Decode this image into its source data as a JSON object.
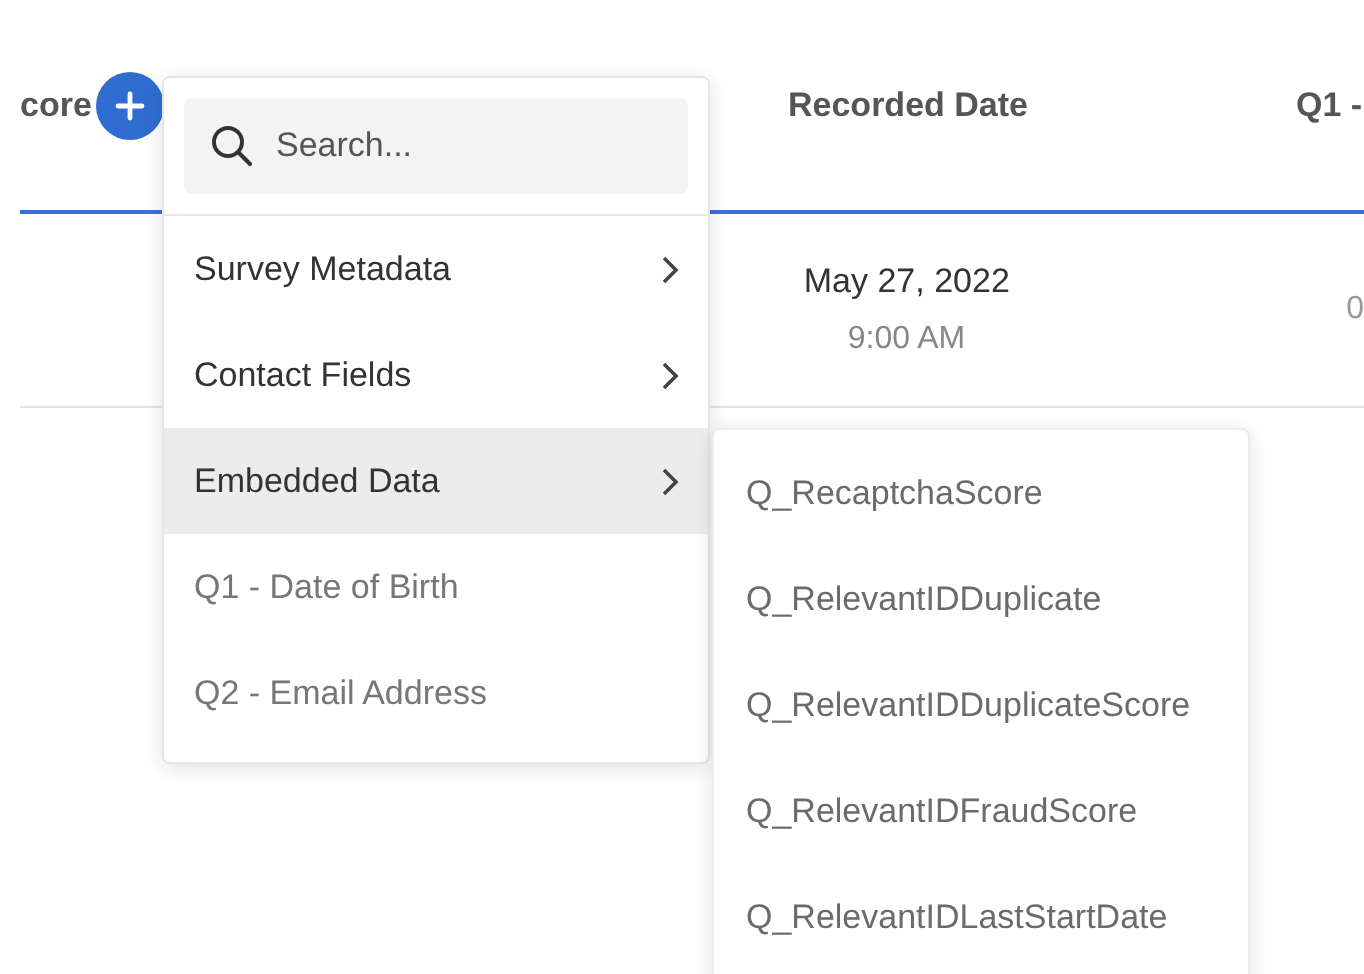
{
  "table": {
    "columns": [
      {
        "label": "core"
      },
      {
        "label": "Recorded Date"
      },
      {
        "label": "Q1 -"
      }
    ],
    "rows": [
      {
        "cells": [
          {
            "text": ""
          },
          {
            "text": "May 27, 2022",
            "subtext": "9:00 AM"
          },
          {
            "text": "0"
          }
        ]
      }
    ]
  },
  "menu": {
    "search": {
      "placeholder": "Search..."
    },
    "items": [
      {
        "label": "Survey Metadata",
        "kind": "category",
        "selected": false
      },
      {
        "label": "Contact Fields",
        "kind": "category",
        "selected": false
      },
      {
        "label": "Embedded Data",
        "kind": "category",
        "selected": true
      },
      {
        "label": "Q1 - Date of Birth",
        "kind": "field",
        "selected": false
      },
      {
        "label": "Q2 - Email Address",
        "kind": "field",
        "selected": false
      }
    ]
  },
  "submenu": {
    "items": [
      "Q_RecaptchaScore",
      "Q_RelevantIDDuplicate",
      "Q_RelevantIDDuplicateScore",
      "Q_RelevantIDFraudScore",
      "Q_RelevantIDLastStartDate"
    ]
  }
}
